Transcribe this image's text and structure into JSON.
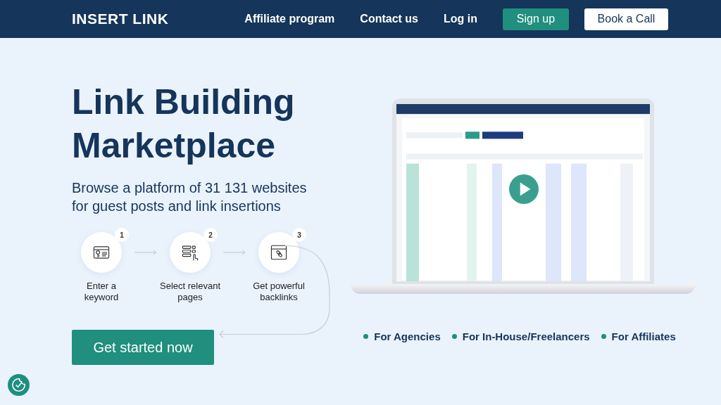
{
  "header": {
    "logo": "INSERT LINK",
    "nav": [
      "Affiliate program",
      "Contact us",
      "Log in"
    ],
    "signup": "Sign up",
    "book": "Book a Call"
  },
  "hero": {
    "title": "Link Building Marketplace",
    "subtitle": "Browse a platform of 31 131 websites for guest posts and link insertions",
    "cta": "Get started now"
  },
  "steps": [
    {
      "number": "1",
      "label": "Enter a keyword",
      "kind": "keyword"
    },
    {
      "number": "2",
      "label": "Select relevant pages",
      "kind": "select"
    },
    {
      "number": "3",
      "label": "Get powerful backlinks",
      "kind": "backlinks"
    }
  ],
  "audiences": [
    "For Agencies",
    "For In-House/Freelancers",
    "For Affiliates"
  ]
}
